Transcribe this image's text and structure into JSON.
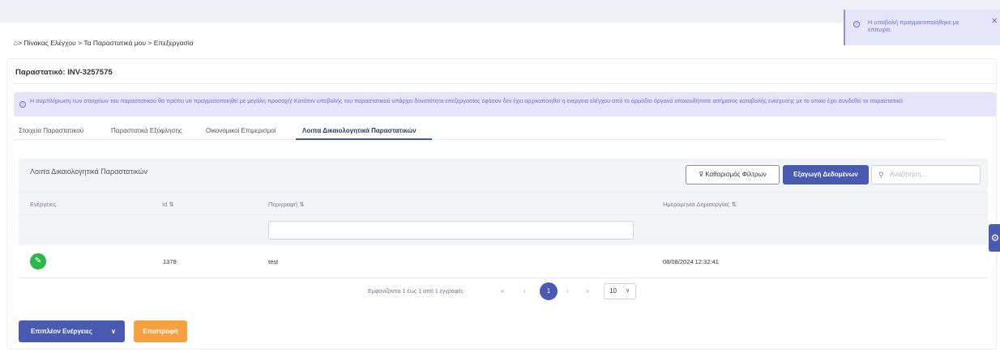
{
  "toast": {
    "message": "Η υποβολή πραγματοποιήθηκε με επιτυχία.",
    "info_icon": "info-icon",
    "close_icon": "close-icon"
  },
  "breadcrumb": {
    "home_icon": "home-icon",
    "items": [
      "Πίνακας Ελέγχου",
      "Τα Παραστατικά μου",
      "Επεξεργασία"
    ],
    "separator": ">"
  },
  "page": {
    "title": "Παραστατικό: INV-3257575"
  },
  "info": {
    "message": "Η συμπλήρωση των στοιχείων του παραστατικού θα πρέπει να πραγματοποιηθεί με μεγάλη προσοχή! Κατόπιν υποβολής του παραστατικού υπάρχει δυνατότητα επεξεργασίας εφόσον δεν έχει αρχικοποιηθεί η ενεργεια ελέγχου από το αρμόδιο όργανο οποιουδήποτε αιτήματος καταβολής ενίσχυσης με το οποίο έχει συνδεθεί το παραστατικό"
  },
  "tabs": [
    {
      "label": "Στοιχεία Παραστατικού",
      "active": false
    },
    {
      "label": "Παραστατικά Εξόφλησης",
      "active": false
    },
    {
      "label": "Οικονομικοί Επιμερισμοί",
      "active": false
    },
    {
      "label": "Λοιπα Δικαιολογητικά Παραστατικών",
      "active": true
    }
  ],
  "panel": {
    "title": "Λοιπα Δικαιολογητικά Παραστατικών",
    "clear_filters_label": "Καθαρισμός Φίλτρων",
    "clear_filters_icon": "filter-icon",
    "export_label": "Εξαγωγή Δεδομένων",
    "search_placeholder": "Αναζήτηση...",
    "search_icon": "search-icon"
  },
  "table": {
    "columns": [
      {
        "label": "Ενέργειες",
        "sortable": false
      },
      {
        "label": "Id",
        "sortable": true,
        "sort_icon": "⇅"
      },
      {
        "label": "Περιγραφή",
        "sortable": true,
        "sort_icon": "⇅"
      },
      {
        "label": "Ημερομηνία Δημιουργίας",
        "sortable": true,
        "sort_icon": "⇅"
      }
    ],
    "rows": [
      {
        "action_icon": "pencil-icon",
        "id": "1378",
        "description": "test",
        "created": "08/08/2024 12:32:41"
      }
    ]
  },
  "pagination": {
    "info": "Εμφανίζονται 1 έως 1 από 1 εγγραφές",
    "first": "«",
    "prev": "‹",
    "current": "1",
    "next": "›",
    "last": "»",
    "page_size": "10"
  },
  "actions": {
    "more_label": "Επιπλέον Ενέργειες",
    "back_label": "Επιστροφή"
  },
  "colors": {
    "primary": "#4a5ab1",
    "success": "#2db54a",
    "warning": "#f5a13f",
    "info_bg": "#e4e4fb",
    "info_text": "#6c6cd6"
  }
}
